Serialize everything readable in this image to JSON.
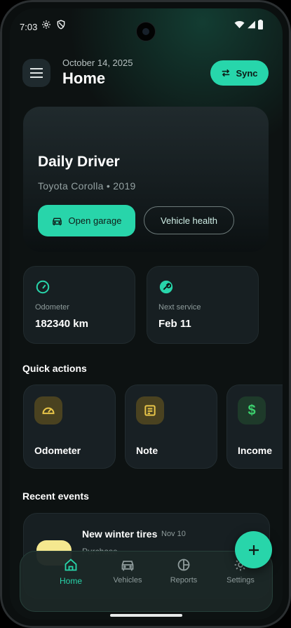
{
  "status_bar": {
    "time": "7:03"
  },
  "header": {
    "date": "October 14, 2025",
    "title": "Home",
    "sync_label": "Sync"
  },
  "vehicle": {
    "name": "Daily Driver",
    "subtitle": "Toyota Corolla • 2019",
    "open_garage_label": "Open garage",
    "vehicle_health_label": "Vehicle health"
  },
  "stats": {
    "odometer": {
      "label": "Odometer",
      "value": "182340 km"
    },
    "next_service": {
      "label": "Next service",
      "value": "Feb 11"
    }
  },
  "quick_actions": {
    "title": "Quick actions",
    "items": [
      {
        "label": "Odometer",
        "icon": "speedometer-icon",
        "color": "#e8c549"
      },
      {
        "label": "Note",
        "icon": "note-icon",
        "color": "#e8c549"
      },
      {
        "label": "Income",
        "icon": "dollar-icon",
        "color": "#3ccf6d"
      }
    ]
  },
  "recent_events": {
    "title": "Recent events",
    "items": [
      {
        "title": "New winter tires",
        "date": "Nov 10",
        "subtitle": "Purchase"
      }
    ]
  },
  "nav": {
    "items": [
      {
        "label": "Home",
        "icon": "home-icon",
        "active": true
      },
      {
        "label": "Vehicles",
        "icon": "car-icon",
        "active": false
      },
      {
        "label": "Reports",
        "icon": "pie-chart-icon",
        "active": false
      },
      {
        "label": "Settings",
        "icon": "gear-icon",
        "active": false
      }
    ]
  },
  "colors": {
    "accent": "#28d5aa",
    "background": "#0d1212",
    "card": "#171f22"
  }
}
